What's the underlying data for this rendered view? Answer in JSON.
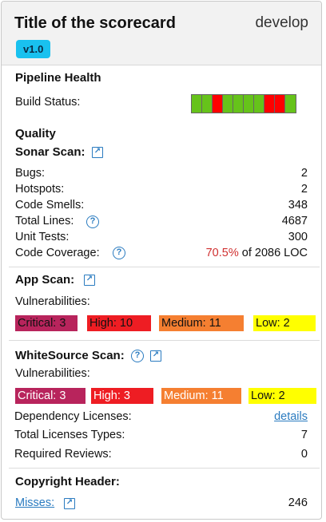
{
  "header": {
    "title": "Title of the scorecard",
    "branch": "develop",
    "version": "v1.0"
  },
  "pipeline": {
    "title": "Pipeline Health",
    "build_status_label": "Build Status:",
    "builds": [
      "green",
      "green",
      "red",
      "green",
      "green",
      "green",
      "green",
      "red",
      "red",
      "green"
    ],
    "colors": {
      "green": "#66c31a",
      "red": "#ff0000"
    }
  },
  "quality": {
    "title": "Quality",
    "sonar": {
      "title": "Sonar Scan:",
      "rows": [
        {
          "label": "Bugs:",
          "value": "2"
        },
        {
          "label": "Hotspots:",
          "value": "2"
        },
        {
          "label": "Code Smells:",
          "value": "348"
        },
        {
          "label": "Total Lines:",
          "value": "4687"
        },
        {
          "label": "Unit Tests:",
          "value": "300"
        }
      ],
      "coverage_label": "Code Coverage:",
      "coverage_pct": "70.5%",
      "coverage_rest": "of 2086 LOC"
    }
  },
  "app_scan": {
    "title": "App Scan:",
    "vuln_label": "Vulnerabilities:",
    "critical": "Critical:  3",
    "high": "High:  10",
    "medium": "Medium:  11",
    "low": "Low:  2"
  },
  "whitesource": {
    "title": "WhiteSource Scan:",
    "vuln_label": "Vulnerabilities:",
    "critical": "Critical:  3",
    "high": "High:  3",
    "medium": "Medium:  11",
    "low": "Low:  2",
    "dependency_label": "Dependency Licenses:",
    "dependency_link": "details",
    "license_types_label": "Total Licenses Types:",
    "license_types_value": "7",
    "reviews_label": "Required Reviews:",
    "reviews_value": "0"
  },
  "copyright": {
    "title": "Copyright Header:",
    "misses_label": "Misses:",
    "misses_value": "246"
  },
  "severity_colors": {
    "critical": "#b8245c",
    "high": "#ee1d23",
    "medium": "#f57f31",
    "low": "#ffff00"
  }
}
